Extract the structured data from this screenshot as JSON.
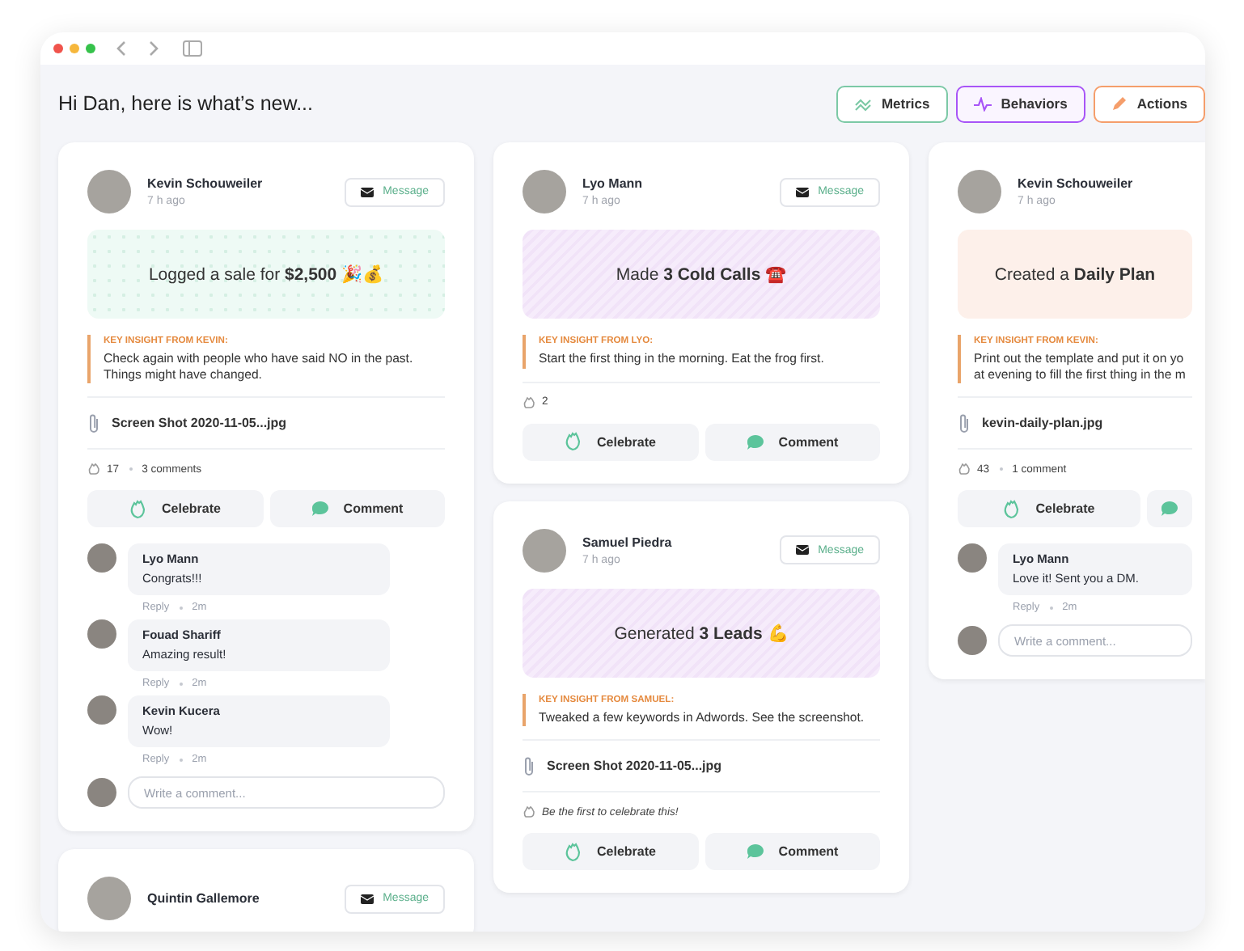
{
  "window": {
    "greeting": "Hi Dan, here is what’s new..."
  },
  "filters": [
    {
      "label": "Metrics",
      "kind": "metrics"
    },
    {
      "label": "Behaviors",
      "kind": "behaviors"
    },
    {
      "label": "Actions",
      "kind": "actions"
    }
  ],
  "columns": [
    {
      "cards": [
        {
          "author": "Kevin Schouweiler",
          "time": "7 h ago",
          "message_button": "Message",
          "activity": {
            "kind": "sale",
            "text": "Logged a sale for **$2,500** 🎉💰"
          },
          "insight": {
            "label": "KEY INSIGHT FROM KEVIN:",
            "text": "Check again with people who have said NO in the past. Things might have changed."
          },
          "attachment": "Screen Shot 2020-11-05...jpg",
          "celebrations": "17",
          "comments_count": "3 comments",
          "actions": [
            {
              "kind": "celebrate",
              "label": "Celebrate"
            },
            {
              "kind": "comment",
              "label": "Comment"
            }
          ],
          "comments": [
            {
              "author": "Lyo Mann",
              "text": "Congrats!!!",
              "reply": "Reply",
              "time": "2m"
            },
            {
              "author": "Fouad Shariff",
              "text": "Amazing result!",
              "reply": "Reply",
              "time": "2m"
            },
            {
              "author": "Kevin Kucera",
              "text": "Wow!",
              "reply": "Reply",
              "time": "2m"
            }
          ],
          "comment_placeholder": "Write a comment..."
        },
        {
          "author": "Quintin Gallemore",
          "message_button": "Message"
        }
      ]
    },
    {
      "cards": [
        {
          "author": "Lyo Mann",
          "time": "7 h ago",
          "message_button": "Message",
          "activity": {
            "kind": "calls",
            "text": "Made **3 Cold Calls** ☎️"
          },
          "insight": {
            "label": "KEY INSIGHT FROM LYO:",
            "text": "Start the first thing in the morning. Eat the frog first."
          },
          "celebrations": "2",
          "actions": [
            {
              "kind": "celebrate",
              "label": "Celebrate"
            },
            {
              "kind": "comment",
              "label": "Comment"
            }
          ]
        },
        {
          "author": "Samuel Piedra",
          "time": "7 h ago",
          "message_button": "Message",
          "activity": {
            "kind": "leads",
            "text": "Generated **3 Leads** 💪"
          },
          "insight": {
            "label": "KEY INSIGHT FROM SAMUEL:",
            "text": "Tweaked a few keywords in Adwords. See the screenshot."
          },
          "attachment": "Screen Shot 2020-11-05...jpg",
          "celebrate_prompt": "Be the first to celebrate this!",
          "actions": [
            {
              "kind": "celebrate",
              "label": "Celebrate"
            },
            {
              "kind": "comment",
              "label": "Comment"
            }
          ]
        }
      ]
    },
    {
      "cards": [
        {
          "author": "Kevin Schouweiler",
          "time": "7 h ago",
          "activity": {
            "kind": "plan",
            "text": "Created a **Daily Plan**"
          },
          "insight": {
            "label": "KEY INSIGHT FROM KEVIN:",
            "text": "Print out the template and put it on yo at evening to fill the first thing in the m"
          },
          "attachment": "kevin-daily-plan.jpg",
          "celebrations": "43",
          "comments_count": "1 comment",
          "actions": [
            {
              "kind": "celebrate",
              "label": "Celebrate"
            },
            {
              "kind": "comment"
            }
          ],
          "comments": [
            {
              "author": "Lyo Mann",
              "text": "Love it! Sent you a DM.",
              "reply": "Reply",
              "time": "2m"
            }
          ],
          "comment_placeholder": "Write a comment..."
        }
      ]
    }
  ]
}
